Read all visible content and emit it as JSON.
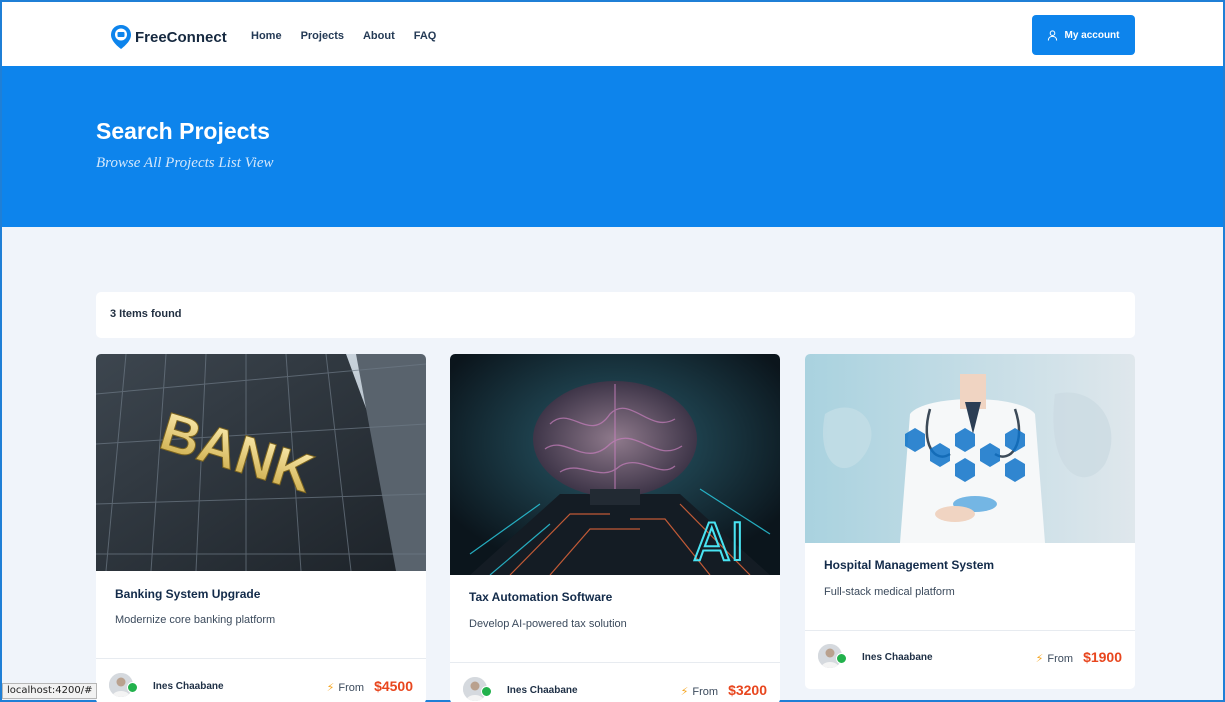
{
  "brand": {
    "name": "FreeConnect"
  },
  "nav": {
    "items": [
      "Home",
      "Projects",
      "About",
      "FAQ"
    ]
  },
  "header": {
    "account_label": "My account"
  },
  "hero": {
    "title": "Search Projects",
    "subtitle": "Browse All Projects List View"
  },
  "results": {
    "count_text": "3 Items found"
  },
  "cards": [
    {
      "title": "Banking System Upgrade",
      "description": "Modernize core banking platform",
      "author": "Ines Chaabane",
      "from_label": "From",
      "price": "$4500",
      "image": "bank-building-image"
    },
    {
      "title": "Tax Automation Software",
      "description": "Develop AI-powered tax solution",
      "author": "Ines Chaabane",
      "from_label": "From",
      "price": "$3200",
      "image": "ai-brain-chip-image"
    },
    {
      "title": "Hospital Management System",
      "description": "Full-stack medical platform",
      "author": "Ines Chaabane",
      "from_label": "From",
      "price": "$1900",
      "image": "doctor-medical-icons-image"
    }
  ],
  "status_bar": {
    "url": "localhost:4200/#"
  },
  "colors": {
    "primary": "#0d84ec",
    "price": "#e8461e",
    "verified": "#22b14c",
    "bolt": "#f5a623"
  }
}
